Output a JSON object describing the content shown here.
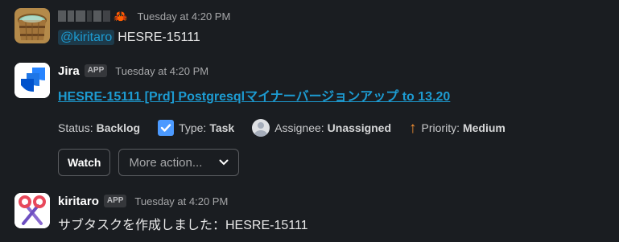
{
  "messages": [
    {
      "sender_redacted": true,
      "sender_emoji": "🦀",
      "timestamp": "Tuesday at 4:20 PM",
      "mention": "@kiritaro",
      "text": "HESRE-15111",
      "avatar_icon": "wooden-tub-icon"
    },
    {
      "sender": "Jira",
      "badge": "APP",
      "timestamp": "Tuesday at 4:20 PM",
      "avatar_icon": "jira-logo-icon",
      "issue_link": "HESRE-15111 [Prd] Postgresqlマイナーバージョンアップ to 13.20",
      "fields": {
        "status_label": "Status:",
        "status_value": "Backlog",
        "type_label": "Type:",
        "type_value": "Task",
        "assignee_label": "Assignee:",
        "assignee_value": "Unassigned",
        "priority_label": "Priority:",
        "priority_value": "Medium"
      },
      "actions": {
        "watch_label": "Watch",
        "more_placeholder": "More action..."
      }
    },
    {
      "sender": "kiritaro",
      "badge": "APP",
      "timestamp": "Tuesday at 4:20 PM",
      "avatar_icon": "scissors-icon",
      "text": "サブタスクを作成しました：HESRE-15111"
    }
  ],
  "colors": {
    "background": "#1a1d21",
    "link": "#1d9bd1",
    "priority_medium": "#f79232",
    "task_type": "#4c9aff"
  }
}
